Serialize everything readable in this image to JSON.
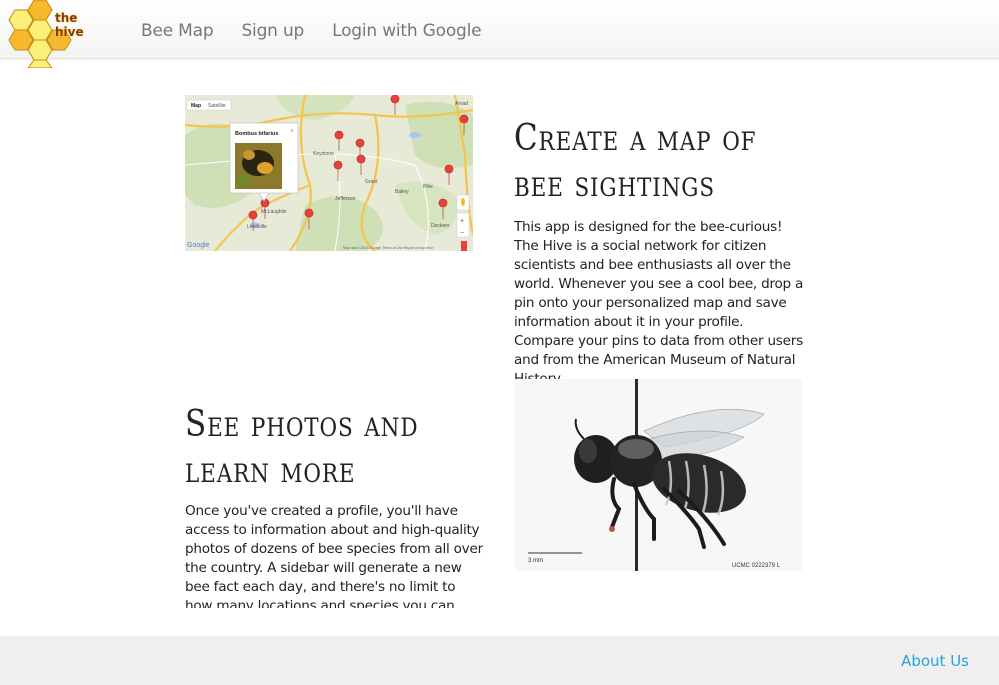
{
  "brand": {
    "name": "the hive",
    "honey_light": "#fbf07a",
    "honey_dark": "#f5b82e",
    "accent": "#8a3b08"
  },
  "nav": {
    "items": [
      "Bee Map",
      "Sign up",
      "Login with Google"
    ]
  },
  "map": {
    "tab_map": "Map",
    "tab_satellite": "Satellite",
    "popup_title": "Bombus bifarius",
    "google": "Google",
    "attribution": "Map data ©2016 Google   Terms of Use   Report a map error",
    "places": [
      "Arvad",
      "Keystone",
      "Grant",
      "Jefferson",
      "Bailey",
      "Pike",
      "Deckers",
      "Leadville",
      "McLaughlin"
    ],
    "zoom_in": "+",
    "zoom_out": "−",
    "pin_color": "#e8403a"
  },
  "sections": {
    "create": {
      "title": "Create a map of bee sightings",
      "body": "This app is designed for the bee-curious! The Hive is a social network for citizen scientists and bee enthusiasts all over the world. Whenever you see a cool bee, drop a pin onto your personalized map and save information about it in your profile. Compare your pins to data from other users and from the American Museum of Natural History."
    },
    "photos": {
      "title": "See photos and learn more",
      "body": "Once you've created a profile, you'll have access to information about and high-quality photos of dozens of bee species from all over the country. A sidebar will generate a new bee fact each day, and there's no limit to how many locations and species you can save."
    }
  },
  "specimen": {
    "scale": "3 mm",
    "label": "UCMC 0222379 L"
  },
  "footer": {
    "about": "About Us",
    "link_color": "#2aa3d8"
  }
}
